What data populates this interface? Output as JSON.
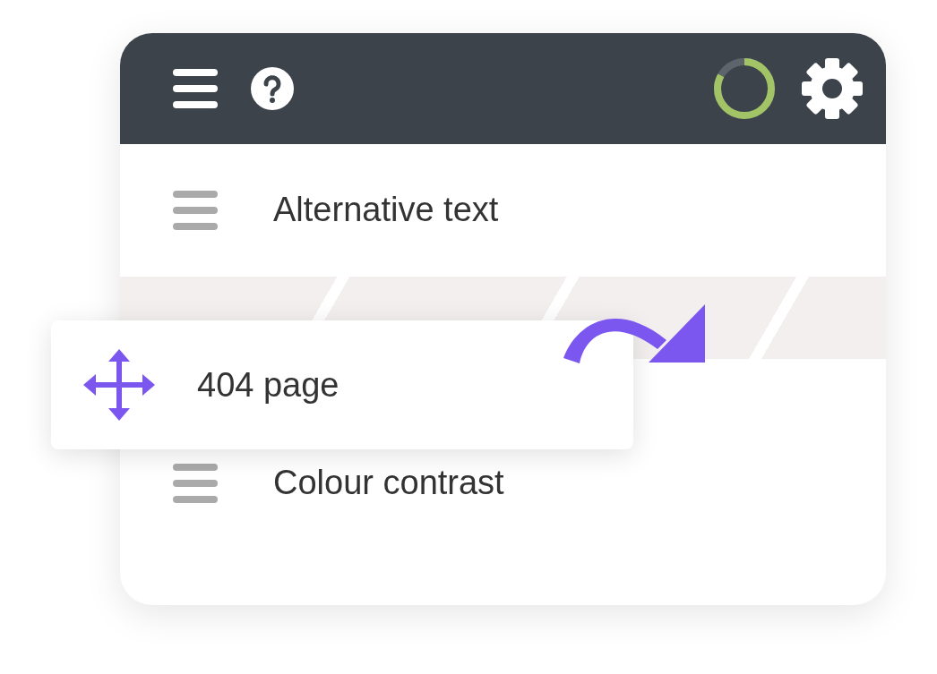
{
  "header": {
    "progress": {
      "level": 0.83
    }
  },
  "items": [
    {
      "label": "Alternative text"
    },
    {
      "label": "Colour contrast"
    }
  ],
  "dragged_item": {
    "label": "404 page"
  }
}
